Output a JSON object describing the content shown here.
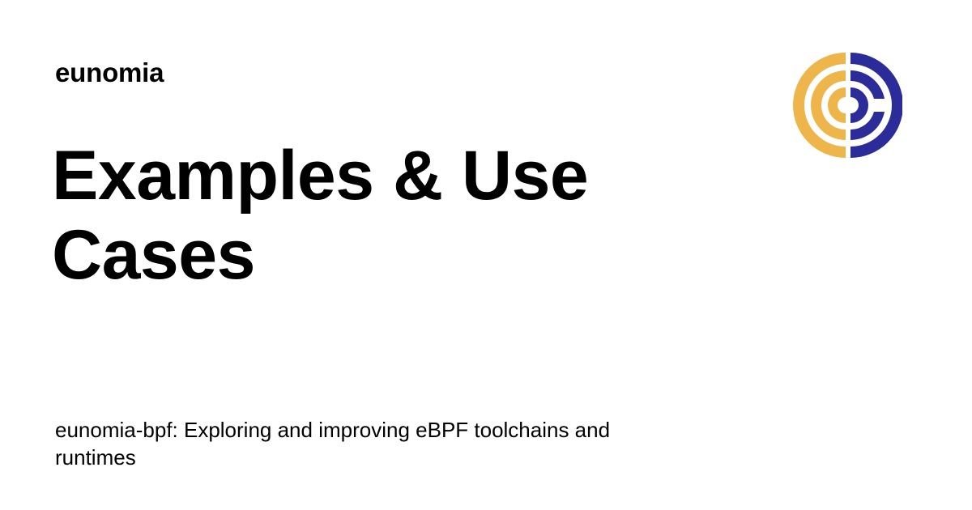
{
  "site": {
    "name": "eunomia"
  },
  "page": {
    "title": "Examples & Use Cases",
    "description": "eunomia-bpf: Exploring and improving eBPF toolchains and runtimes"
  },
  "logo": {
    "icon": "eunomia-logo-icon",
    "colors": {
      "left": "#EDB54A",
      "right": "#2B2C9A",
      "center": "#FFFFFF"
    }
  }
}
